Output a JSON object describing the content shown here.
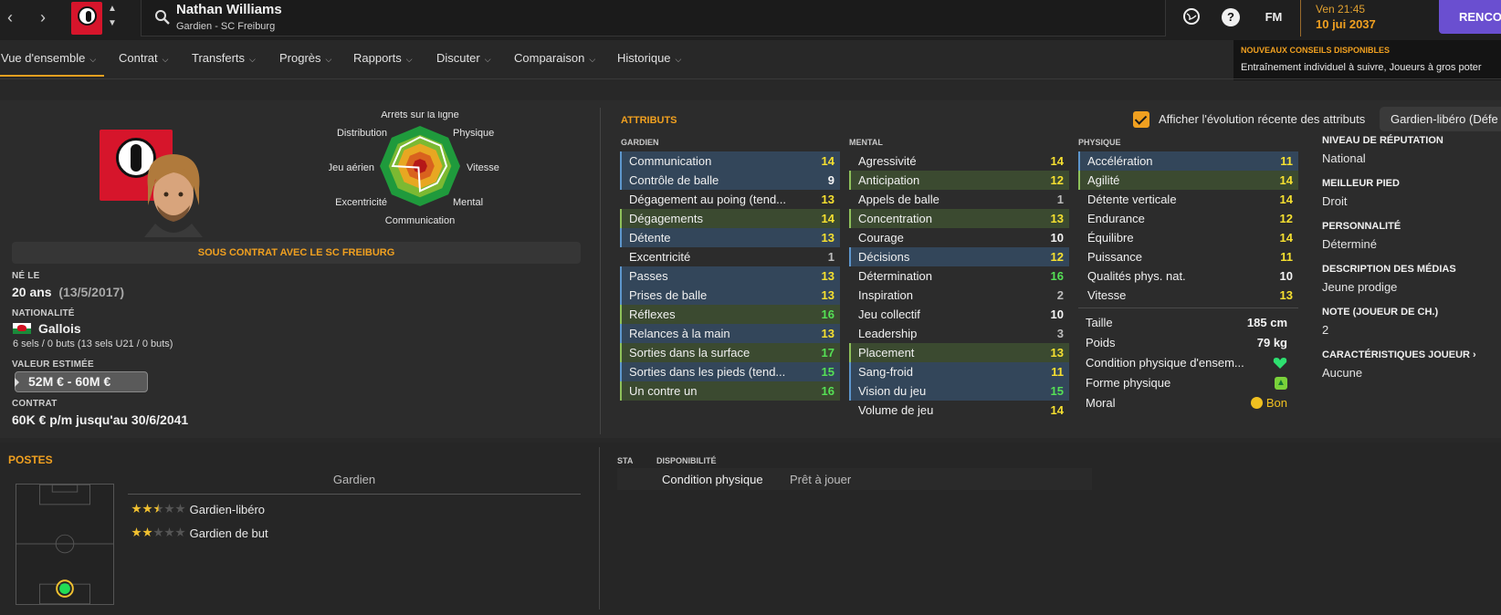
{
  "topbar": {
    "player_name": "Nathan Williams",
    "player_sub": "Gardien - SC Freiburg",
    "icons": [
      "back-arrow-icon",
      "forward-arrow-icon",
      "club-crest-icon",
      "up-arrow-icon",
      "down-arrow-icon",
      "search-icon",
      "globe-icon",
      "help-icon"
    ],
    "fm_label": "FM",
    "time": "Ven 21:45",
    "date": "10 jui 2037",
    "continue_label": "RENCO"
  },
  "notification": {
    "title": "NOUVEAUX CONSEILS DISPONIBLES",
    "text": "Entraînement individuel à suivre, Joueurs à gros poter"
  },
  "tabs": [
    {
      "label": "Vue d'ensemble"
    },
    {
      "label": "Contrat"
    },
    {
      "label": "Transferts"
    },
    {
      "label": "Progrès"
    },
    {
      "label": "Rapports"
    },
    {
      "label": "Discuter"
    },
    {
      "label": "Comparaison"
    },
    {
      "label": "Historique"
    }
  ],
  "profile": {
    "contract_band": "SOUS CONTRAT AVEC LE SC FREIBURG",
    "born_label": "NÉ LE",
    "age": "20 ans",
    "birthdate": "(13/5/2017)",
    "nationality_label": "NATIONALITÉ",
    "nationality": "Gallois",
    "caps": "6 sels / 0 buts (13 sels U21 / 0 buts)",
    "value_label": "VALEUR ESTIMÉE",
    "value": "52M € - 60M €",
    "contract_label": "CONTRAT",
    "contract": "60K € p/m jusqu'au 30/6/2041"
  },
  "radar": {
    "labels": [
      "Arrêts sur la ligne",
      "Physique",
      "Vitesse",
      "Mental",
      "Communication",
      "Excentricité",
      "Jeu aérien",
      "Distribution"
    ],
    "ratios": [
      0.72,
      0.72,
      0.66,
      0.6,
      0.62,
      0.05,
      0.68,
      0.67
    ],
    "colors": {
      "outer": "#1f9a3c",
      "ring2": "#7cb932",
      "ring3": "#e8a722",
      "ring4": "#d9621e",
      "inner": "#b51818",
      "line": "#ffffff"
    }
  },
  "attributes": {
    "title": "ATTRIBUTS",
    "show_evolution_label": "Afficher l'évolution récente des attributs",
    "show_evolution_checked": true,
    "role_select": "Gardien-libéro (Défe",
    "goalkeeper": {
      "heading": "GARDIEN",
      "items": [
        {
          "name": "Communication",
          "value": "14",
          "hl": "blue"
        },
        {
          "name": "Contrôle de balle",
          "value": "9",
          "hl": "blue"
        },
        {
          "name": "Dégagement au poing (tend...",
          "value": "13",
          "hl": "plain"
        },
        {
          "name": "Dégagements",
          "value": "14",
          "hl": "green"
        },
        {
          "name": "Détente",
          "value": "13",
          "hl": "blue"
        },
        {
          "name": "Excentricité",
          "value": "1",
          "hl": "plain"
        },
        {
          "name": "Passes",
          "value": "13",
          "hl": "blue"
        },
        {
          "name": "Prises de balle",
          "value": "13",
          "hl": "blue"
        },
        {
          "name": "Réflexes",
          "value": "16",
          "hl": "green"
        },
        {
          "name": "Relances à la main",
          "value": "13",
          "hl": "blue"
        },
        {
          "name": "Sorties dans la surface",
          "value": "17",
          "hl": "green"
        },
        {
          "name": "Sorties dans les pieds (tend...",
          "value": "15",
          "hl": "blue"
        },
        {
          "name": "Un contre un",
          "value": "16",
          "hl": "green"
        }
      ]
    },
    "mental": {
      "heading": "MENTAL",
      "items": [
        {
          "name": "Agressivité",
          "value": "14",
          "hl": "plain"
        },
        {
          "name": "Anticipation",
          "value": "12",
          "hl": "green"
        },
        {
          "name": "Appels de balle",
          "value": "1",
          "hl": "plain"
        },
        {
          "name": "Concentration",
          "value": "13",
          "hl": "green"
        },
        {
          "name": "Courage",
          "value": "10",
          "hl": "plain"
        },
        {
          "name": "Décisions",
          "value": "12",
          "hl": "blue"
        },
        {
          "name": "Détermination",
          "value": "16",
          "hl": "plain"
        },
        {
          "name": "Inspiration",
          "value": "2",
          "hl": "plain"
        },
        {
          "name": "Jeu collectif",
          "value": "10",
          "hl": "plain"
        },
        {
          "name": "Leadership",
          "value": "3",
          "hl": "plain"
        },
        {
          "name": "Placement",
          "value": "13",
          "hl": "green"
        },
        {
          "name": "Sang-froid",
          "value": "11",
          "hl": "blue"
        },
        {
          "name": "Vision du jeu",
          "value": "15",
          "hl": "blue"
        },
        {
          "name": "Volume de jeu",
          "value": "14",
          "hl": "plain"
        }
      ]
    },
    "physical": {
      "heading": "PHYSIQUE",
      "items": [
        {
          "name": "Accélération",
          "value": "11",
          "hl": "blue"
        },
        {
          "name": "Agilité",
          "value": "14",
          "hl": "green"
        },
        {
          "name": "Détente verticale",
          "value": "14",
          "hl": "plain"
        },
        {
          "name": "Endurance",
          "value": "12",
          "hl": "plain"
        },
        {
          "name": "Équilibre",
          "value": "14",
          "hl": "plain"
        },
        {
          "name": "Puissance",
          "value": "11",
          "hl": "plain"
        },
        {
          "name": "Qualités phys. nat.",
          "value": "10",
          "hl": "plain"
        },
        {
          "name": "Vitesse",
          "value": "13",
          "hl": "plain"
        }
      ]
    },
    "extra": {
      "height_label": "Taille",
      "height": "185 cm",
      "weight_label": "Poids",
      "weight": "79 kg",
      "condition_label": "Condition physique d'ensem...",
      "form_label": "Forme physique",
      "morale_label": "Moral",
      "morale": "Bon"
    }
  },
  "info": {
    "reputation_label": "NIVEAU DE RÉPUTATION",
    "reputation": "National",
    "foot_label": "MEILLEUR PIED",
    "foot": "Droit",
    "personality_label": "PERSONNALITÉ",
    "personality": "Déterminé",
    "media_label": "DESCRIPTION DES MÉDIAS",
    "media": "Jeune prodige",
    "rating_label": "NOTE (JOUEUR DE CH.)",
    "rating": "2",
    "traits_label": "CARACTÉRISTIQUES JOUEUR",
    "traits": "Aucune"
  },
  "positions": {
    "title": "POSTES",
    "heading": "Gardien",
    "roles": [
      {
        "name": "Gardien-libéro",
        "stars": 2.5
      },
      {
        "name": "Gardien de but",
        "stars": 2
      }
    ]
  },
  "availability": {
    "sta_label": "STA",
    "dispo_label": "DISPONIBILITÉ",
    "condition": "Condition physique",
    "ready": "Prêt à jouer"
  }
}
